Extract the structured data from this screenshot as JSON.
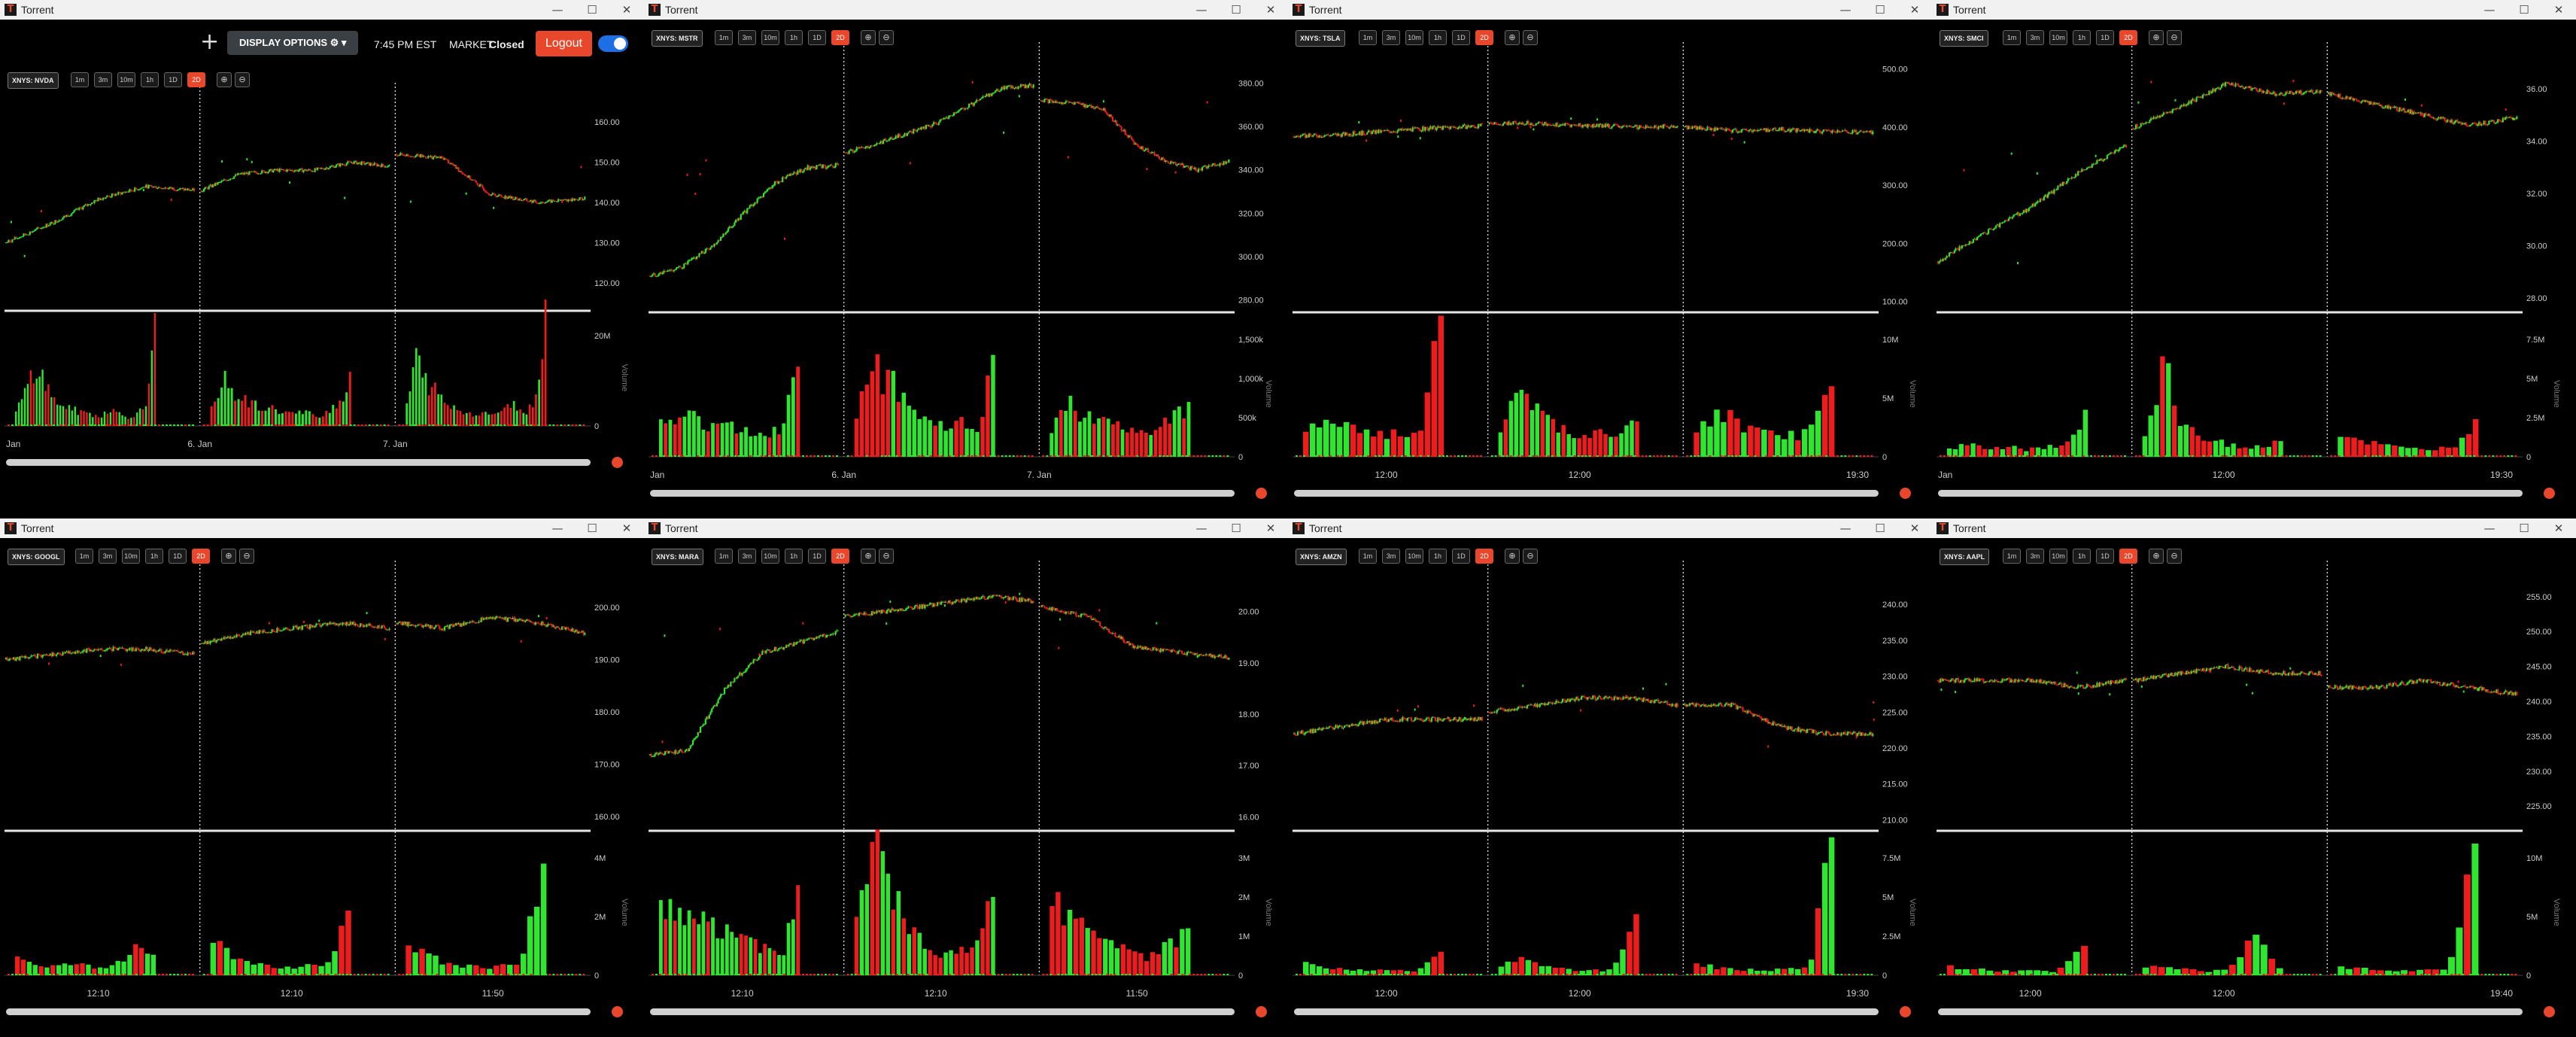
{
  "header": {
    "add_label": "+",
    "display_options_label": "DISPLAY OPTIONS ⚙ ▾",
    "time": "7:45 PM EST",
    "market_label": "MARKET",
    "market_status": "Closed",
    "logout_label": "Logout"
  },
  "window_controls": {
    "minimize": "—",
    "maximize": "☐",
    "close": "✕"
  },
  "zoom_icons": {
    "zoom_in": "⊕",
    "zoom_out": "⊖"
  },
  "timeframes": [
    "1m",
    "3m",
    "10m",
    "1h",
    "1D",
    "2D"
  ],
  "active_timeframe": "2D",
  "colors": {
    "up": "#2ee62e",
    "down": "#ee1c1c",
    "accent": "#e8472b",
    "toggle": "#1e6fe6"
  },
  "windows": [
    {
      "title": "Torrent",
      "symbol": "XNYS: NVDA",
      "price_ticks": [
        "160.00",
        "150.00",
        "140.00",
        "130.00",
        "120.00"
      ],
      "price_range": [
        114,
        166
      ],
      "volume_ticks": [
        "20M",
        "0"
      ],
      "volume_max_label": 20,
      "volume_axis_label": "Volume",
      "x_labels": [
        "Jan",
        "6. Jan",
        "7. Jan"
      ],
      "chart_data": {
        "type": "candlestick",
        "sessions": [
          [
            130,
            135,
            141,
            144,
            143
          ],
          [
            143,
            147,
            148,
            148,
            150,
            149
          ],
          [
            152,
            151,
            142,
            140,
            141
          ]
        ],
        "vol": [
          [
            3,
            8,
            14,
            11,
            6,
            5,
            4,
            3,
            3,
            2,
            4,
            3,
            2,
            3,
            4,
            25
          ],
          [
            4,
            11,
            8,
            6,
            5,
            4,
            4,
            3,
            3,
            3,
            2,
            4,
            5,
            12
          ],
          [
            5,
            16,
            10,
            8,
            5,
            4,
            3,
            3,
            3,
            3,
            4,
            5,
            3,
            6,
            28
          ]
        ]
      }
    },
    {
      "title": "Torrent",
      "symbol": "XNYS: MSTR",
      "price_ticks": [
        "380.00",
        "360.00",
        "340.00",
        "320.00",
        "300.00",
        "280.00"
      ],
      "price_range": [
        276,
        392
      ],
      "volume_ticks": [
        "1,500k",
        "1,000k",
        "500k",
        "0"
      ],
      "volume_max_label": 1500,
      "volume_axis_label": "Volume",
      "x_labels": [
        "Jan",
        "6. Jan",
        "7. Jan"
      ],
      "chart_data": {
        "type": "candlestick",
        "sessions": [
          [
            291,
            295,
            305,
            320,
            334,
            341,
            342
          ],
          [
            348,
            352,
            357,
            362,
            370,
            378,
            379
          ],
          [
            372,
            371,
            368,
            352,
            344,
            340,
            344
          ]
        ],
        "vol": [
          [
            450,
            600,
            550,
            400,
            380,
            420,
            350,
            300,
            400,
            1150
          ],
          [
            500,
            1300,
            1000,
            600,
            500,
            400,
            450,
            350,
            1300
          ],
          [
            300,
            700,
            600,
            550,
            400,
            350,
            300,
            400,
            500,
            700
          ]
        ]
      }
    },
    {
      "title": "Torrent",
      "symbol": "XNYS: TSLA",
      "price_ticks": [
        "500.00",
        "400.00",
        "300.00",
        "200.00",
        "100.00"
      ],
      "price_range": [
        88,
        520
      ],
      "volume_ticks": [
        "10M",
        "5M",
        "0"
      ],
      "volume_max_label": 10,
      "volume_axis_label": "Volume",
      "x_labels": [
        "12:00",
        "12:00",
        "19:30"
      ],
      "chart_data": {
        "type": "candlestick",
        "sessions": [
          [
            384,
            387,
            393,
            398,
            402
          ],
          [
            405,
            407,
            404,
            402,
            400,
            401
          ],
          [
            400,
            394,
            396,
            392,
            390
          ]
        ],
        "vol": [
          [
            2,
            4,
            3,
            2,
            2,
            2,
            12
          ],
          [
            2,
            6,
            4,
            3,
            2,
            2,
            2,
            2,
            3
          ],
          [
            2,
            4,
            3,
            2,
            2,
            2,
            6
          ]
        ]
      }
    },
    {
      "title": "Torrent",
      "symbol": "XNYS: SMCI",
      "price_ticks": [
        "36.00",
        "34.00",
        "32.00",
        "30.00",
        "28.00"
      ],
      "price_range": [
        27.6,
        37.2
      ],
      "volume_ticks": [
        "7.5M",
        "5M",
        "2.5M",
        "0"
      ],
      "volume_max_label": 7.5,
      "volume_axis_label": "Volume",
      "x_labels": [
        "Jan",
        "12:00",
        "19:30"
      ],
      "chart_data": {
        "type": "candlestick",
        "sessions": [
          [
            29.4,
            30.5,
            31.5,
            32.8,
            33.8
          ],
          [
            34.5,
            35.3,
            36.2,
            35.8,
            35.9
          ],
          [
            35.8,
            35.4,
            35.0,
            34.6,
            34.9
          ]
        ],
        "vol": [
          [
            0.5,
            0.8,
            0.6,
            0.7,
            0.5,
            0.6,
            0.8,
            3.0
          ],
          [
            1.2,
            5.9,
            2.0,
            1.2,
            0.9,
            0.7,
            0.6,
            1.0
          ],
          [
            1.5,
            1.0,
            0.7,
            0.5,
            0.5,
            0.6,
            2.4
          ]
        ]
      }
    },
    {
      "title": "Torrent",
      "symbol": "XNYS: GOOGL",
      "price_ticks": [
        "200.00",
        "190.00",
        "180.00",
        "170.00",
        "160.00"
      ],
      "price_range": [
        158,
        206
      ],
      "volume_ticks": [
        "4M",
        "2M",
        "0"
      ],
      "volume_max_label": 4,
      "volume_axis_label": "Volume",
      "x_labels": [
        "12:10",
        "12:10",
        "11:50"
      ],
      "chart_data": {
        "type": "candlestick",
        "sessions": [
          [
            190,
            191,
            192,
            192,
            191
          ],
          [
            193,
            195,
            196,
            197,
            196
          ],
          [
            197,
            196,
            198,
            197,
            195
          ]
        ],
        "vol": [
          [
            0.6,
            0.3,
            0.3,
            0.4,
            0.3,
            0.3,
            1.0,
            0.7
          ],
          [
            1.5,
            0.5,
            0.4,
            0.3,
            0.3,
            0.4,
            2.2
          ],
          [
            1.0,
            0.6,
            0.4,
            0.3,
            0.3,
            0.4,
            3.8
          ]
        ]
      }
    },
    {
      "title": "Torrent",
      "symbol": "XNYS: MARA",
      "price_ticks": [
        "20.00",
        "19.00",
        "18.00",
        "17.00",
        "16.00"
      ],
      "price_range": [
        15.8,
        20.7
      ],
      "volume_ticks": [
        "3M",
        "2M",
        "1M",
        "0"
      ],
      "volume_max_label": 3,
      "volume_axis_label": "Volume",
      "x_labels": [
        "12:10",
        "12:10",
        "11:50"
      ],
      "chart_data": {
        "type": "candlestick",
        "sessions": [
          [
            17.2,
            17.3,
            18.5,
            19.2,
            19.4,
            19.6
          ],
          [
            19.9,
            20.0,
            20.1,
            20.2,
            20.3,
            20.2
          ],
          [
            20.1,
            19.9,
            19.3,
            19.2,
            19.1
          ]
        ],
        "vol": [
          [
            1.8,
            2.0,
            1.6,
            1.4,
            1.2,
            1.0,
            0.8,
            0.7,
            0.5,
            2.3
          ],
          [
            1.5,
            3.4,
            2.5,
            1.2,
            0.8,
            0.6,
            0.8,
            0.7,
            2.0
          ],
          [
            2.2,
            1.5,
            1.0,
            0.8,
            0.6,
            0.5,
            0.8,
            1.2
          ]
        ]
      }
    },
    {
      "title": "Torrent",
      "symbol": "XNYS: AMZN",
      "price_ticks": [
        "240.00",
        "235.00",
        "230.00",
        "225.00",
        "220.00",
        "215.00",
        "210.00"
      ],
      "price_range": [
        209,
        244
      ],
      "volume_ticks": [
        "7.5M",
        "5M",
        "2.5M",
        "0"
      ],
      "volume_max_label": 7.5,
      "volume_axis_label": "Volume",
      "x_labels": [
        "12:00",
        "12:00",
        "19:30"
      ],
      "chart_data": {
        "type": "candlestick",
        "sessions": [
          [
            222,
            223,
            224,
            224,
            224
          ],
          [
            225,
            226,
            227,
            227,
            226
          ],
          [
            226,
            226,
            223,
            222,
            222
          ]
        ],
        "vol": [
          [
            0.8,
            0.5,
            0.4,
            0.3,
            0.4,
            0.3,
            1.5
          ],
          [
            0.7,
            1.2,
            0.5,
            0.4,
            0.3,
            0.4,
            3.9
          ],
          [
            0.7,
            0.5,
            0.4,
            0.3,
            0.4,
            0.5,
            8.8
          ]
        ]
      }
    },
    {
      "title": "Torrent",
      "symbol": "XNYS: AAPL",
      "price_ticks": [
        "255.00",
        "250.00",
        "245.00",
        "240.00",
        "235.00",
        "230.00",
        "225.00"
      ],
      "price_range": [
        222,
        258
      ],
      "volume_ticks": [
        "10M",
        "5M",
        "0"
      ],
      "volume_max_label": 10,
      "volume_axis_label": "Volume",
      "x_labels": [
        "12:00",
        "12:00",
        "19:40"
      ],
      "chart_data": {
        "type": "candlestick",
        "sessions": [
          [
            243,
            243,
            243,
            242,
            243
          ],
          [
            243,
            244,
            245,
            244,
            244
          ],
          [
            242,
            242,
            243,
            242,
            241
          ]
        ],
        "vol": [
          [
            0.8,
            0.5,
            0.4,
            0.4,
            0.3,
            2.5
          ],
          [
            0.8,
            0.6,
            0.4,
            0.4,
            3.5,
            0.6
          ],
          [
            0.8,
            0.5,
            0.4,
            0.4,
            0.5,
            11.2
          ]
        ]
      }
    }
  ]
}
